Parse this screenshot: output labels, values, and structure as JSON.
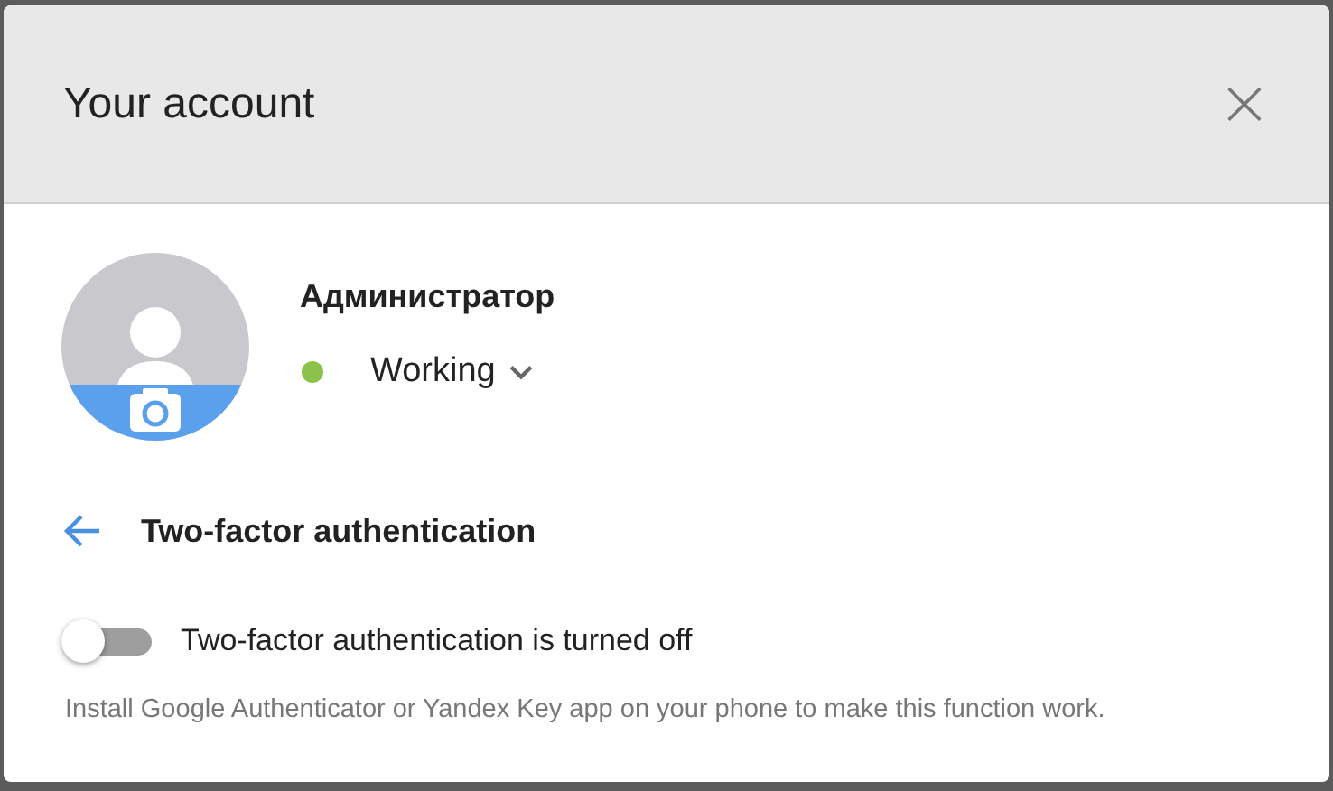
{
  "dialog": {
    "title": "Your account",
    "close": "×"
  },
  "user": {
    "name": "Администратор",
    "status": {
      "label": "Working",
      "color": "#8bc34a"
    }
  },
  "section": {
    "title": "Two-factor authentication"
  },
  "toggle": {
    "label": "Two-factor authentication is turned off",
    "on": false
  },
  "hint": "Install Google Authenticator or Yandex Key app on your phone to make this function work."
}
